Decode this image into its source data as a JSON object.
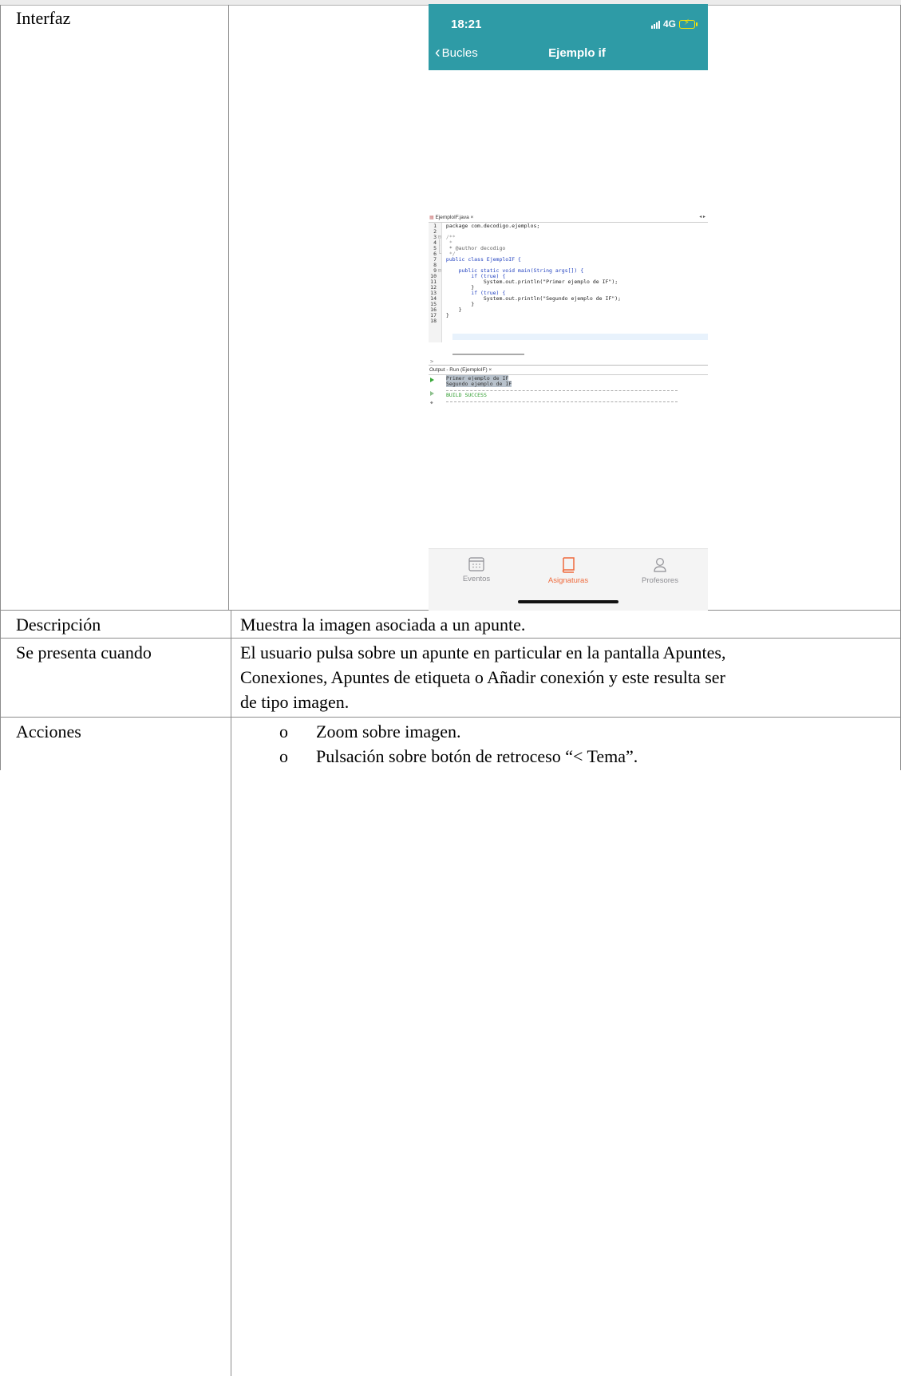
{
  "table": {
    "rows": [
      {
        "label": "Interfaz"
      },
      {
        "label": "Descripción",
        "text": "Muestra la imagen asociada a un apunte."
      },
      {
        "label": "Se presenta cuando",
        "text_lines": [
          "El usuario pulsa sobre un apunte en particular en la pantalla Apuntes,",
          "Conexiones, Apuntes de etiqueta o Añadir conexión y este resulta ser",
          "de tipo imagen."
        ]
      },
      {
        "label": "Acciones",
        "bullet": "o",
        "items": [
          "Zoom sobre imagen.",
          "Pulsación sobre botón de retroceso “< Tema”."
        ]
      }
    ]
  },
  "phone": {
    "status_time": "18:21",
    "network": "4G",
    "back_label": "Bucles",
    "nav_title": "Ejemplo if",
    "code_image": {
      "tab_label": "EjemploIF.java ×",
      "lines": [
        {
          "n": "1",
          "text": "package com.decodigo.ejemplos;"
        },
        {
          "n": "2",
          "text": ""
        },
        {
          "n": "3",
          "text": "/**"
        },
        {
          "n": "4",
          "text": " *"
        },
        {
          "n": "5",
          "text": " * @author decodigo"
        },
        {
          "n": "6",
          "text": " */"
        },
        {
          "n": "7",
          "text": "public class EjemploIF {"
        },
        {
          "n": "8",
          "text": ""
        },
        {
          "n": "9",
          "text": "    public static void main(String args[]) {"
        },
        {
          "n": "10",
          "text": "        if (true) {"
        },
        {
          "n": "11",
          "text": "            System.out.println(\"Primer ejemplo de IF\");"
        },
        {
          "n": "12",
          "text": "        }"
        },
        {
          "n": "13",
          "text": "        if (true) {"
        },
        {
          "n": "14",
          "text": "            System.out.println(\"Segundo ejemplo de IF\");"
        },
        {
          "n": "15",
          "text": "        }"
        },
        {
          "n": "16",
          "text": "    }"
        },
        {
          "n": "17",
          "text": "}"
        },
        {
          "n": "18",
          "text": ""
        }
      ],
      "output_title": "Output - Run (EjemploIF) ×",
      "output_lines": [
        "Primer ejemplo de IF",
        "Segundo ejemplo de IF"
      ],
      "build_status": "BUILD SUCCESS"
    },
    "tabs": [
      {
        "label": "Eventos",
        "icon": "calendar-icon",
        "active": false
      },
      {
        "label": "Asignaturas",
        "icon": "book-icon",
        "active": true
      },
      {
        "label": "Profesores",
        "icon": "person-icon",
        "active": false
      }
    ],
    "colors": {
      "nav_bar": "#2e9ba6",
      "active_tab": "#ef6a3c",
      "inactive_tab": "#8e8e93"
    }
  }
}
